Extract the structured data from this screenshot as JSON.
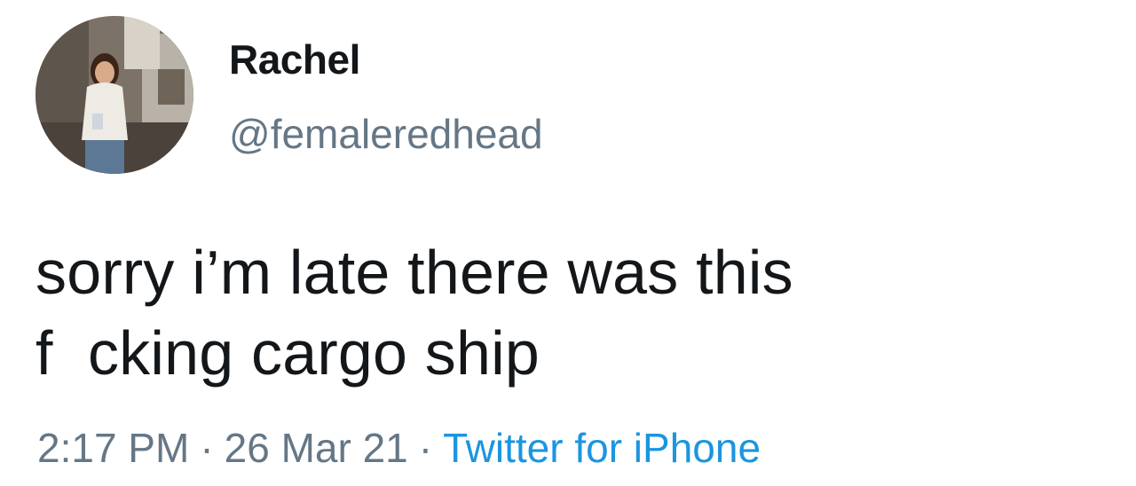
{
  "user": {
    "display_name": "Rachel",
    "handle": "@femaleredhead",
    "avatar_icon": "profile-photo"
  },
  "tweet": {
    "text_lines": [
      "sorry i’m late there was this",
      "f  cking cargo ship"
    ]
  },
  "meta": {
    "time": "2:17 PM",
    "separator": "·",
    "date": "26 Mar 21",
    "source": "Twitter for iPhone"
  },
  "colors": {
    "text": "#14171a",
    "secondary": "#657786",
    "link": "#1b95e0"
  }
}
